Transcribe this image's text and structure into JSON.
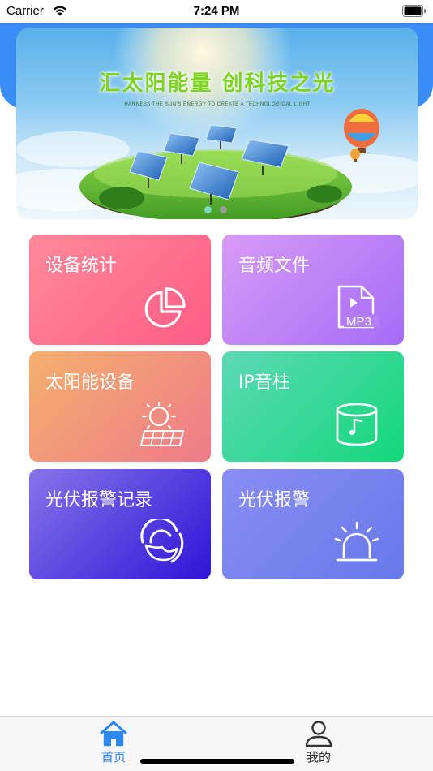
{
  "status_bar": {
    "carrier": "Carrier",
    "time": "7:24 PM"
  },
  "banner": {
    "title": "汇太阳能量  创科技之光",
    "subtitle": "HARNESS THE SUN'S ENERGY TO CREATE A TECHNOLOGICAL LIGHT",
    "page_count": 2,
    "active_page": 1,
    "active_dot_color": "#7fd8c6",
    "dot_color": "#9a9a9a"
  },
  "tiles": [
    {
      "label": "设备统计",
      "icon": "pie-chart-icon",
      "color_from": "#ff8a9a",
      "color_to": "#ff5b85"
    },
    {
      "label": "音频文件",
      "icon": "mp3-file-icon",
      "color_from": "#d79bf6",
      "color_to": "#a56cf7",
      "icon_text": "MP3"
    },
    {
      "label": "太阳能设备",
      "icon": "solar-panel-icon",
      "color_from": "#f5b06d",
      "color_to": "#ee7a8a"
    },
    {
      "label": "IP音柱",
      "icon": "speaker-column-icon",
      "color_from": "#5dd9b6",
      "color_to": "#12d87a"
    },
    {
      "label": "光伏报警记录",
      "icon": "alarm-record-icon",
      "color_from": "#8774ea",
      "color_to": "#2f14d6"
    },
    {
      "label": "光伏报警",
      "icon": "alarm-light-icon",
      "color_from": "#8a8df4",
      "color_to": "#6779ea"
    }
  ],
  "tabbar": {
    "items": [
      {
        "label": "首页",
        "icon": "home-icon",
        "active": true
      },
      {
        "label": "我的",
        "icon": "user-icon",
        "active": false
      }
    ],
    "active_color": "#2f87f0",
    "inactive_color": "#333333"
  }
}
